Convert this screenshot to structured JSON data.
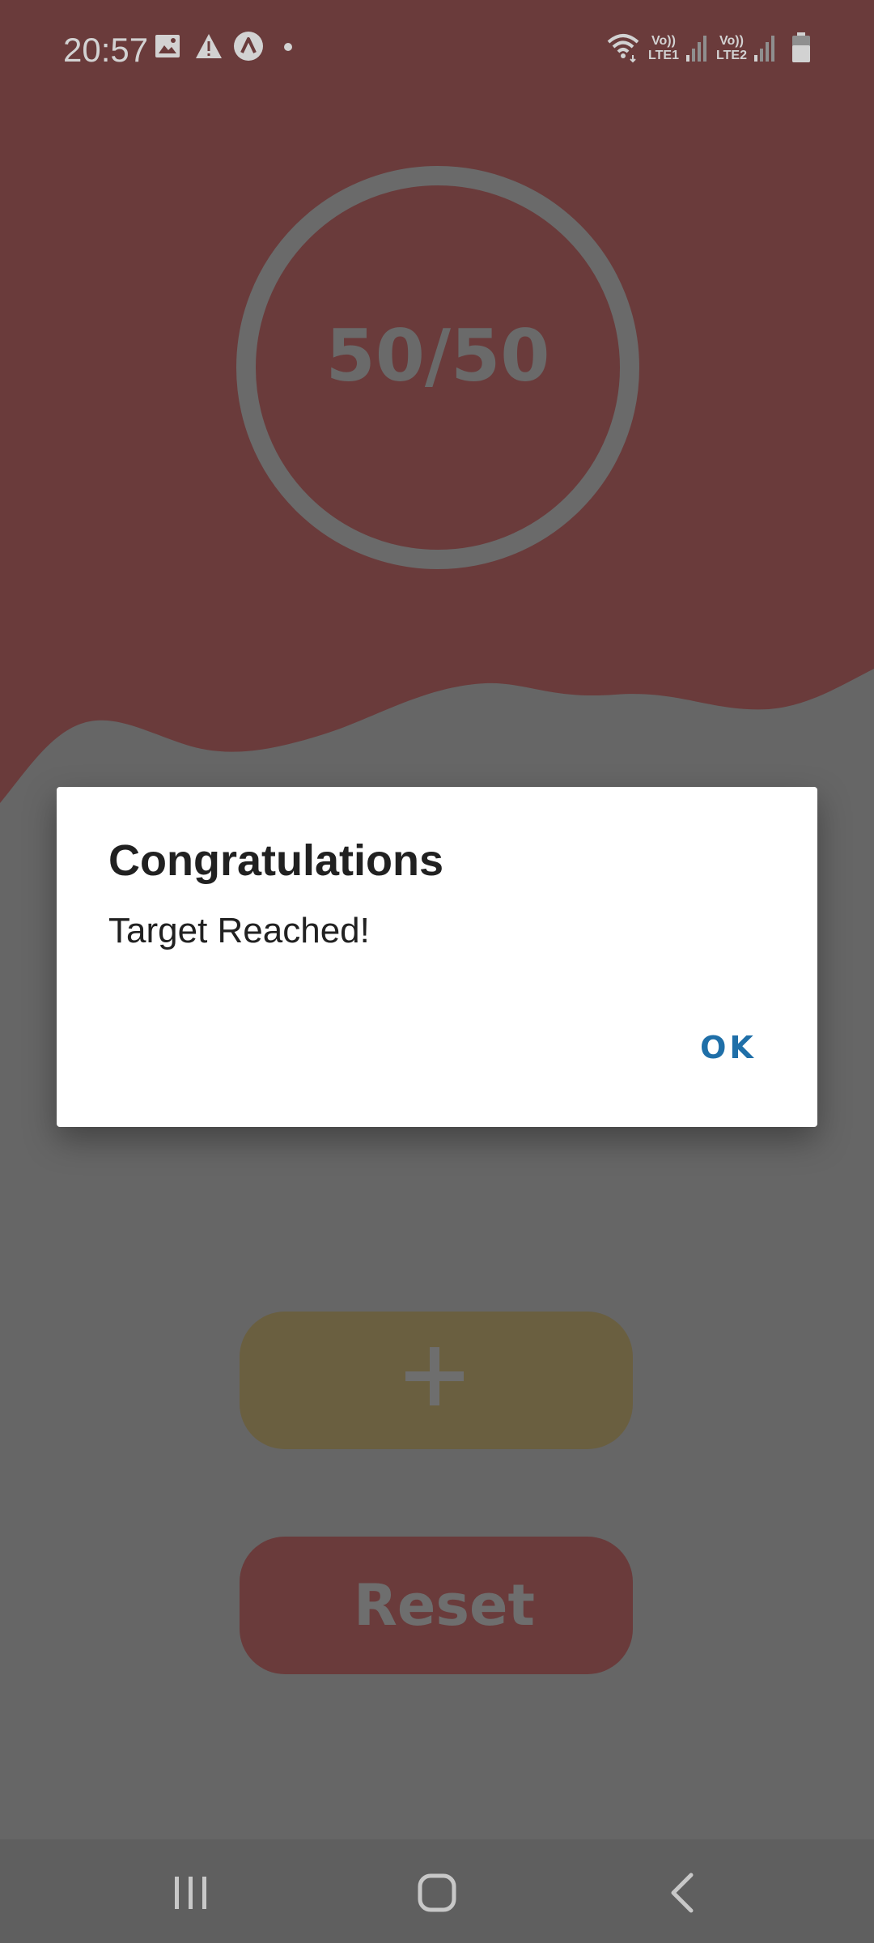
{
  "status_bar": {
    "time": "20:57",
    "left_icons": [
      "image-icon",
      "warning-icon",
      "app-a-icon",
      "dot-icon"
    ],
    "right_icons": [
      "wifi-icon",
      "signal-lte1-icon",
      "signal-lte2-icon",
      "battery-icon"
    ],
    "lte1_label_top": "Vo))",
    "lte1_label_bottom": "LTE1",
    "lte2_label_top": "Vo))",
    "lte2_label_bottom": "LTE2"
  },
  "counter": {
    "text": "50/50",
    "current": 50,
    "target": 50
  },
  "buttons": {
    "plus_icon": "plus-icon",
    "reset_label": "Reset"
  },
  "dialog": {
    "title": "Congratulations",
    "message": "Target Reached!",
    "ok_label": "OK"
  },
  "nav_bar": {
    "icons": [
      "recent-apps-icon",
      "home-icon",
      "back-icon"
    ]
  },
  "colors": {
    "top_background": "#6a3b3b",
    "bottom_background": "#666666",
    "plus_button": "#6a5f40",
    "reset_button": "#6a3b3b",
    "dialog_ok": "#1f6fa8",
    "dialog_background": "#ffffff"
  }
}
